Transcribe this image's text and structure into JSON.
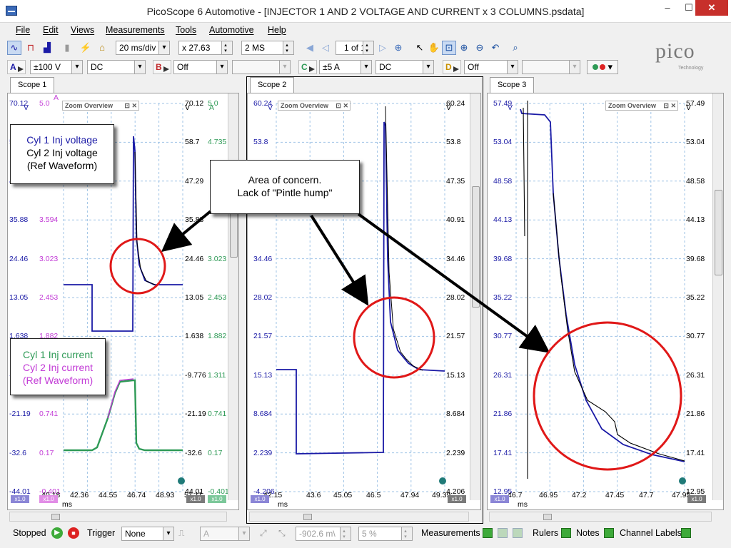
{
  "window": {
    "title": "PicoScope 6 Automotive - [INJECTOR 1 AND 2 VOLTAGE AND CURRENT x 3 COLUMNS.psdata]",
    "min_glyph": "–",
    "max_glyph": "☐",
    "close_glyph": "✕"
  },
  "menu": [
    "File",
    "Edit",
    "Views",
    "Measurements",
    "Tools",
    "Automotive",
    "Help"
  ],
  "toolbar": {
    "timebase": "20 ms/div",
    "zoom": "x 27.63",
    "samples": "2 MS",
    "page": "1 of 1"
  },
  "channels": {
    "a": {
      "label": "A",
      "range": "±100 V",
      "coupling": "DC"
    },
    "b": {
      "label": "B",
      "range": "Off",
      "coupling": ""
    },
    "c": {
      "label": "C",
      "range": "±5 A",
      "coupling": "DC"
    },
    "d": {
      "label": "D",
      "range": "Off",
      "coupling": ""
    }
  },
  "logo": {
    "name": "pico",
    "sub": "Technology"
  },
  "scopes": [
    {
      "tab": "Scope 1",
      "zoom_overview": "Zoom Overview",
      "left_axis_v": [
        "70.12",
        "58.7",
        "47.29",
        "35.88",
        "24.46",
        "13.05",
        "1.638",
        "-9.776",
        "-21.19",
        "-32.6",
        "-44.01"
      ],
      "left_axis_a": [
        "5.0",
        "",
        "",
        "3.594",
        "3.023",
        "2.453",
        "1.882",
        "",
        "0.741",
        "0.17",
        "-0.401"
      ],
      "right_axis_v": [
        "70.12",
        "58.7",
        "47.29",
        "35.88",
        "24.46",
        "13.05",
        "1.638",
        "-9.776",
        "-21.19",
        "-32.6",
        "44.01"
      ],
      "right_axis_a": [
        "5.0",
        "4.735",
        "",
        "",
        "3.023",
        "2.453",
        "1.882",
        "1.311",
        "0.741",
        "0.17",
        "-0.401"
      ],
      "unit_v": "V",
      "unit_a": "A",
      "x_ticks": [
        "40.18",
        "42.36",
        "44.55",
        "46.74",
        "48.93",
        "51.11"
      ],
      "x_unit": "ms",
      "badge_x": "x1.0"
    },
    {
      "tab": "Scope 2",
      "zoom_overview": "Zoom Overview",
      "left_axis_v": [
        "60.24",
        "53.8",
        "",
        "",
        "34.46",
        "28.02",
        "21.57",
        "15.13",
        "8.684",
        "2.239",
        "-4.206"
      ],
      "right_axis_v": [
        "60.24",
        "53.8",
        "47.35",
        "40.91",
        "34.46",
        "28.02",
        "21.57",
        "15.13",
        "8.684",
        "2.239",
        "4.206"
      ],
      "unit_v": "V",
      "x_ticks": [
        "42.15",
        "43.6",
        "45.05",
        "46.5",
        "47.94",
        "49.39"
      ],
      "x_unit": "ms",
      "badge_x": "x1.0"
    },
    {
      "tab": "Scope 3",
      "zoom_overview": "Zoom Overview",
      "left_axis_v": [
        "57.49",
        "53.04",
        "48.58",
        "44.13",
        "39.68",
        "35.22",
        "30.77",
        "26.31",
        "21.86",
        "17.41",
        "12.95"
      ],
      "right_axis_v": [
        "57.49",
        "53.04",
        "48.58",
        "44.13",
        "39.68",
        "35.22",
        "30.77",
        "26.31",
        "21.86",
        "17.41",
        "12.95"
      ],
      "unit_v": "V",
      "x_ticks": [
        "46.7",
        "46.95",
        "47.2",
        "47.45",
        "47.7",
        "47.95"
      ],
      "x_unit": "ms",
      "badge_x": "x1.0"
    }
  ],
  "annotations": {
    "voltage_legend": [
      "Cyl 1 Inj voltage",
      "Cyl 2 Inj voltage",
      "(Ref Waveform)"
    ],
    "current_legend": [
      "Cyl 1 Inj current",
      "Cyl 2 Inj current",
      "(Ref Waveform)"
    ],
    "concern": [
      "Area of concern.",
      "Lack of \"Pintle hump\""
    ]
  },
  "status": {
    "state": "Stopped",
    "trigger_label": "Trigger",
    "trigger_mode": "None",
    "trigger_channel": "A",
    "trigger_level": "-902.6 m\\",
    "trigger_pct": "5 %",
    "measurements": "Measurements",
    "rulers": "Rulers",
    "notes": "Notes",
    "channel_labels": "Channel Labels"
  },
  "colors": {
    "blue": "#1a1aa6",
    "magenta": "#c23bd6",
    "green": "#2e9a56",
    "black": "#000000",
    "red": "#e01818"
  }
}
